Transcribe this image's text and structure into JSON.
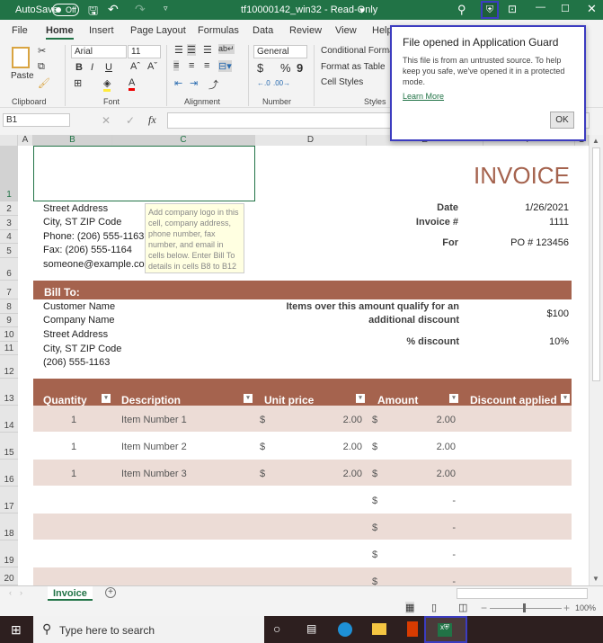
{
  "titlebar": {
    "autosave": "AutoSave",
    "autosave_state": "Off",
    "title": "tf10000142_win32  -  Read-Only",
    "title_arrow": "▾",
    "accent": "#217346"
  },
  "tabs": [
    "File",
    "Home",
    "Insert",
    "Page Layout",
    "Formulas",
    "Data",
    "Review",
    "View",
    "Help"
  ],
  "ribbon": {
    "clipboard": {
      "label": "Clipboard",
      "paste": "Paste"
    },
    "font": {
      "label": "Font",
      "family": "Arial",
      "size": "11",
      "bold": "B",
      "italic": "I",
      "underline": "U"
    },
    "alignment": {
      "label": "Alignment"
    },
    "number": {
      "label": "Number",
      "format": "General",
      "currency": "$",
      "percent": "%",
      "comma": "9"
    },
    "styles": {
      "label": "Styles",
      "conditional": "Conditional Formatting",
      "table": "Format as Table",
      "cell": "Cell Styles"
    }
  },
  "formula_bar": {
    "name_box": "B1",
    "fx": "fx",
    "value": ""
  },
  "columns": [
    "A",
    "B",
    "C",
    "D",
    "E",
    "F",
    "G"
  ],
  "rows": [
    "1",
    "2",
    "3",
    "4",
    "5",
    "6",
    "7",
    "8",
    "9",
    "10",
    "11",
    "12",
    "13",
    "14",
    "15",
    "16",
    "17",
    "18",
    "19",
    "20"
  ],
  "sheet": {
    "title": "INVOICE",
    "company": [
      "Street Address",
      "City, ST  ZIP Code",
      "Phone: (206) 555-1163",
      "Fax: (206) 555-1164",
      "someone@example.com"
    ],
    "tooltip": "Add company logo in this cell, company address, phone number, fax number, and email in cells below. Enter Bill To details in cells B8 to B12",
    "date_label": "Date",
    "date": "1/26/2021",
    "invoice_label": "Invoice #",
    "invoice": "1111",
    "for_label": "For",
    "for": "PO # 123456",
    "bill_to": "Bill To:",
    "customer": [
      "Customer Name",
      "Company Name",
      "Street Address",
      "City, ST  ZIP Code",
      "(206) 555-1163"
    ],
    "discount_note_1": "Items over this amount qualify for an",
    "discount_note_2": "additional discount",
    "threshold": "$100",
    "pct_label": "% discount",
    "pct": "10%",
    "headers": [
      "Quantity",
      "Description",
      "Unit price",
      "Amount",
      "Discount applied"
    ],
    "items": [
      {
        "qty": "1",
        "desc": "Item Number 1",
        "cur1": "$",
        "price": "2.00",
        "cur2": "$",
        "amount": "2.00"
      },
      {
        "qty": "1",
        "desc": "Item Number 2",
        "cur1": "$",
        "price": "2.00",
        "cur2": "$",
        "amount": "2.00"
      },
      {
        "qty": "1",
        "desc": "Item Number 3",
        "cur1": "$",
        "price": "2.00",
        "cur2": "$",
        "amount": "2.00"
      },
      {
        "qty": "",
        "desc": "",
        "cur1": "",
        "price": "",
        "cur2": "$",
        "amount": "-"
      },
      {
        "qty": "",
        "desc": "",
        "cur1": "",
        "price": "",
        "cur2": "$",
        "amount": "-"
      },
      {
        "qty": "",
        "desc": "",
        "cur1": "",
        "price": "",
        "cur2": "$",
        "amount": "-"
      },
      {
        "qty": "",
        "desc": "",
        "cur1": "",
        "price": "",
        "cur2": "$",
        "amount": "-"
      }
    ],
    "brand": "#a5634e",
    "band_light": "#ecdcd6"
  },
  "sheet_tabs": {
    "active": "Invoice",
    "add": "+"
  },
  "status": {
    "zoom": "100%"
  },
  "popup": {
    "title": "File opened in Application Guard",
    "body": "This file is from an untrusted source. To help keep you safe, we've opened it in a protected mode.",
    "link": "Learn More",
    "ok": "OK"
  },
  "taskbar": {
    "search_placeholder": "Type here to search"
  }
}
